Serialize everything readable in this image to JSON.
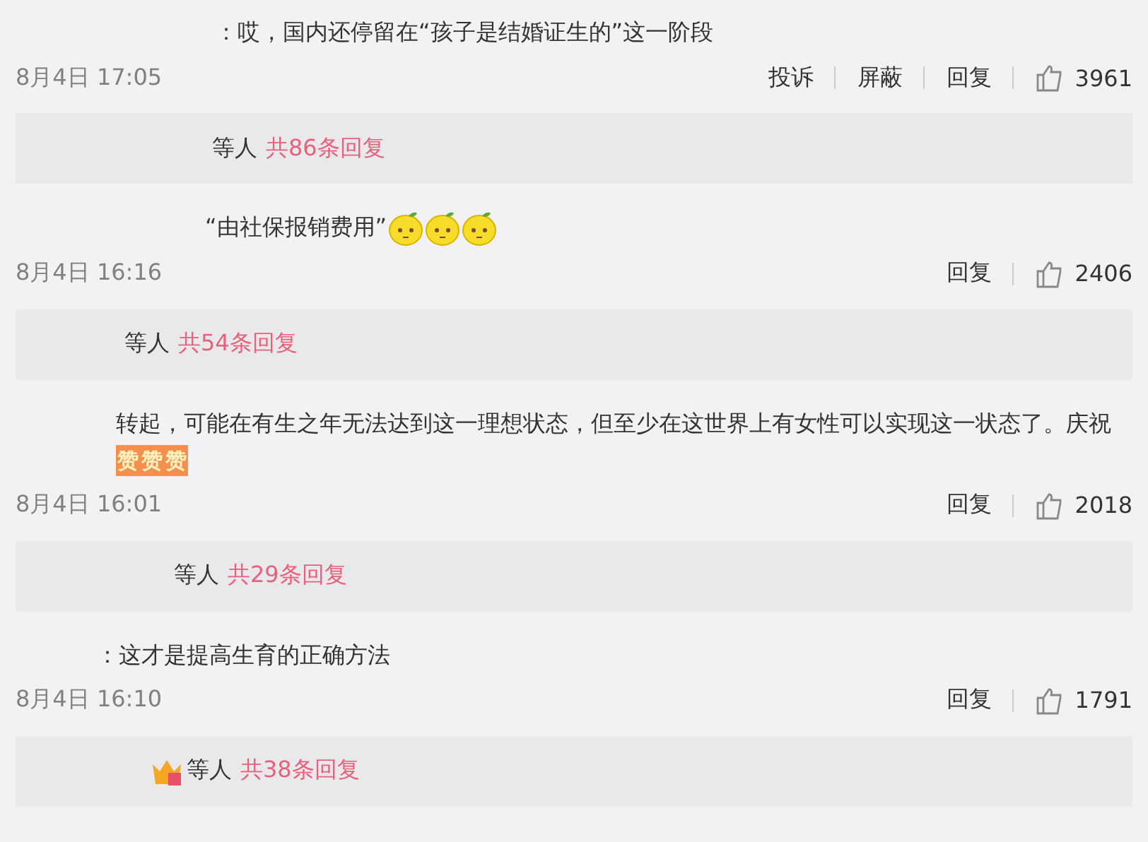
{
  "comments": [
    {
      "text": "：哎，国内还停留在“孩子是结婚证生的”这一阶段",
      "time": "8月4日 17:05",
      "actions": [
        "投诉",
        "屏蔽",
        "回复"
      ],
      "likes": "3961",
      "reply_summary": {
        "prefix": "等人",
        "count_link": "共86条回复",
        "crown": false
      }
    },
    {
      "text": "“由社保报销费用”",
      "emojis": [
        {
          "kind": "lemon"
        },
        {
          "kind": "lemon"
        },
        {
          "kind": "lemon"
        }
      ],
      "time": "8月4日 16:16",
      "actions": [
        "回复"
      ],
      "likes": "2406",
      "reply_summary": {
        "prefix": "等人",
        "count_link": "共54条回复",
        "crown": false
      }
    },
    {
      "text": "转起，可能在有生之年无法达到这一理想状态，但至少在这世界上有女性可以实现这一状态了。庆祝",
      "emojis": [
        {
          "kind": "zan",
          "label": "赞"
        },
        {
          "kind": "zan",
          "label": "赞"
        },
        {
          "kind": "zan",
          "label": "赞"
        }
      ],
      "time": "8月4日 16:01",
      "actions": [
        "回复"
      ],
      "likes": "2018",
      "reply_summary": {
        "prefix": "等人",
        "count_link": "共29条回复",
        "crown": false
      }
    },
    {
      "text": "：这才是提高生育的正确方法",
      "time": "8月4日 16:10",
      "actions": [
        "回复"
      ],
      "likes": "1791",
      "reply_summary": {
        "prefix": "等人",
        "count_link": "共38条回复",
        "crown": true
      }
    }
  ]
}
